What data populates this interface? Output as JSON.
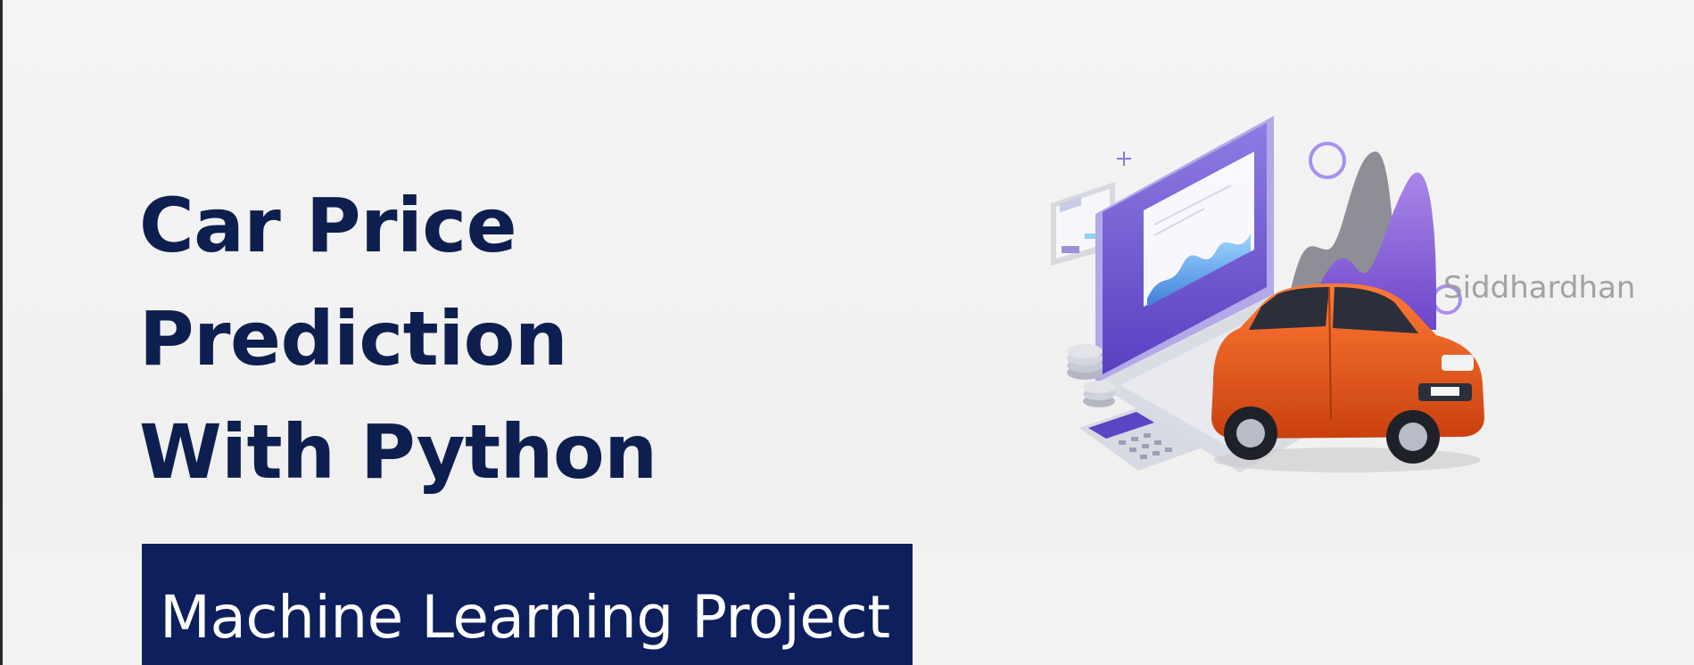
{
  "slide": {
    "title_lines": [
      "Car Price",
      "Prediction",
      "With Python"
    ],
    "banner": "Machine Learning Project",
    "watermark": "Siddhardhan"
  },
  "colors": {
    "title": "#0d1f4f",
    "banner_bg": "#0d1f5c",
    "accent_purple": "#7b5cc9",
    "car_orange": "#e2581c"
  },
  "illustration": {
    "icons": [
      "laptop-chart-icon",
      "mountain-chart-icon",
      "coin-stack-icon",
      "calculator-icon",
      "car-icon"
    ]
  }
}
